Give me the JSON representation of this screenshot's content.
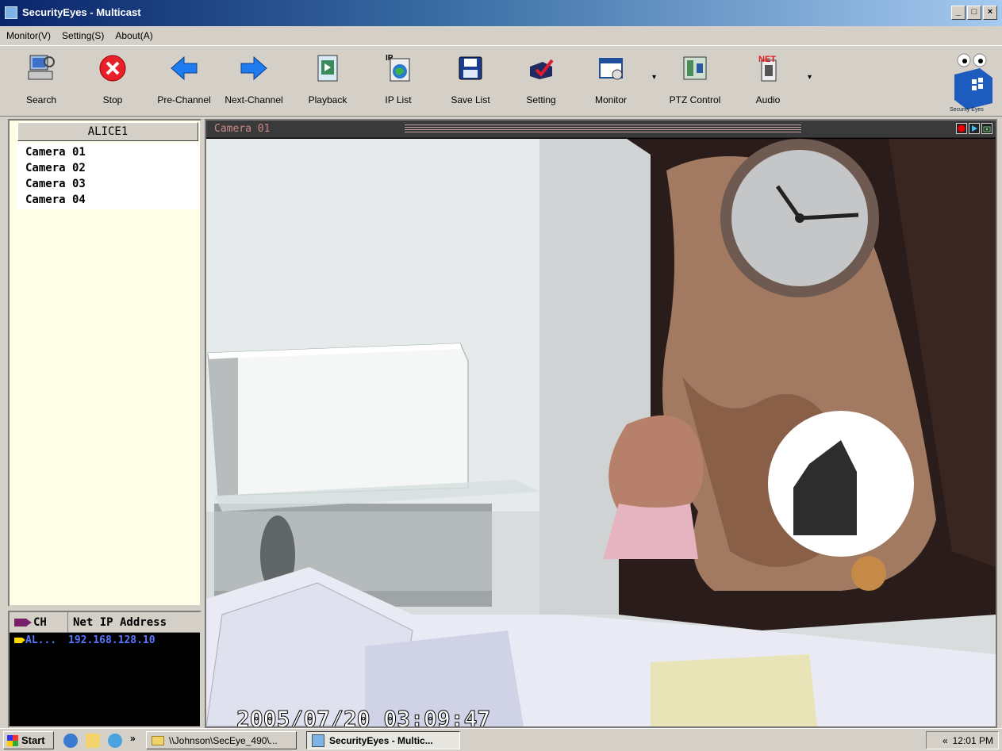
{
  "window": {
    "title": "SecurityEyes - Multicast",
    "controls": [
      "_",
      "□",
      "×"
    ]
  },
  "menu": [
    {
      "label": "Monitor(V)"
    },
    {
      "label": "Setting(S)"
    },
    {
      "label": "About(A)"
    }
  ],
  "toolbar": {
    "search": "Search",
    "stop": "Stop",
    "pre_channel": "Pre-Channel",
    "next_channel": "Next-Channel",
    "playback": "Playback",
    "ip_list": "IP List",
    "save_list": "Save List",
    "setting": "Setting",
    "monitor": "Monitor",
    "ptz_control": "PTZ Control",
    "audio": "Audio",
    "ip_badge": "IP",
    "net_badge": "NET",
    "logo_text": "Security Eyes"
  },
  "device_tree": {
    "header": "ALICE1",
    "cameras": [
      "Camera 01",
      "Camera 02",
      "Camera 03",
      "Camera 04"
    ]
  },
  "channel_table": {
    "col_ch": "CH",
    "col_ip": "Net IP Address",
    "rows": [
      {
        "ch": "AL...",
        "ip": "192.168.128.10"
      }
    ]
  },
  "video": {
    "title": "Camera 01",
    "timestamp": "2005/07/20 03:09:47"
  },
  "taskbar": {
    "start": "Start",
    "chevron": "»",
    "items": [
      "\\\\Johnson\\SecEye_490\\...",
      "SecurityEyes - Multic..."
    ],
    "tray_chevron": "«",
    "clock": "12:01 PM"
  },
  "colors": {
    "title_gradient_start": "#0a246a",
    "title_gradient_end": "#a6caf0",
    "tree_bg": "#fffee6",
    "ip_text": "#5577ff"
  }
}
